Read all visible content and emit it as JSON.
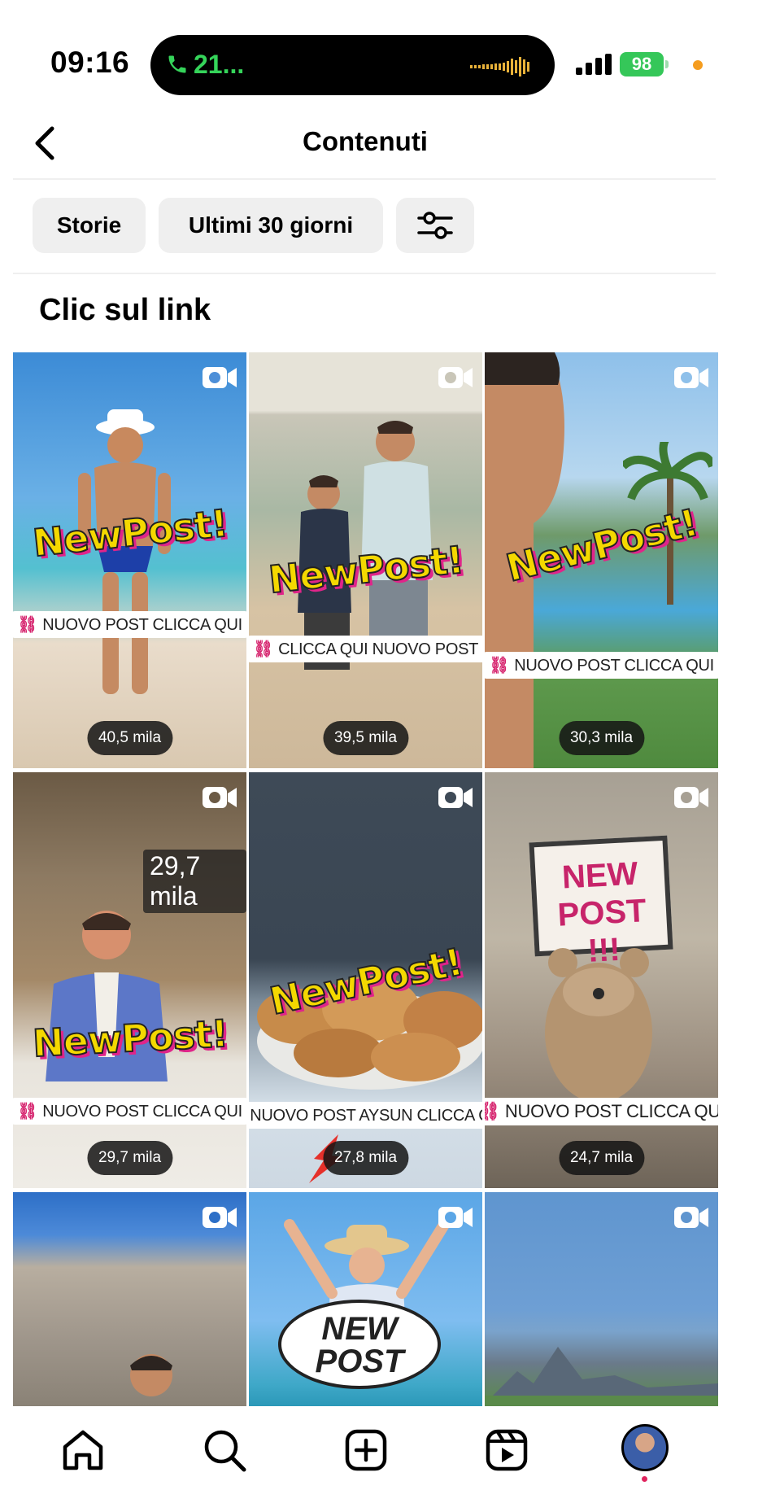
{
  "status_bar": {
    "time": "09:16",
    "call_label": "21...",
    "battery": "98"
  },
  "header": {
    "title": "Contenuti"
  },
  "filters": {
    "type": "Storie",
    "period": "Ultimi 30 giorni"
  },
  "section": {
    "title": "Clic sul link"
  },
  "grid": [
    {
      "stat": "40,5 mila",
      "sticker": "NUOVO POST CLICCA QUI",
      "headline": "NewPost!"
    },
    {
      "stat": "39,5 mila",
      "sticker": "CLICCA QUI NUOVO POST",
      "headline": "NewPost!"
    },
    {
      "stat": "30,3 mila",
      "sticker": "NUOVO POST CLICCA QUI",
      "headline": "NewPost!"
    },
    {
      "stat": "29,7 mila",
      "sticker": "NUOVO POST CLICCA QUI",
      "headline": "NewPost!",
      "overlay": "29,7 mila"
    },
    {
      "stat": "27,8 mila",
      "sticker": "NUOVO POST AYSUN CLICCA QUI",
      "headline": "NewPost!"
    },
    {
      "stat": "24,7 mila",
      "sticker": "NUOVO POST CLICCA QUI",
      "headline": "NEW POST !!!"
    },
    {
      "stat": "",
      "sticker": "",
      "headline": ""
    },
    {
      "stat": "",
      "sticker": "",
      "headline": "NEW POST"
    },
    {
      "stat": "",
      "sticker": "",
      "headline": ""
    }
  ],
  "nav": {
    "icons": [
      "home-icon",
      "search-icon",
      "create-icon",
      "reels-icon",
      "profile-avatar"
    ]
  },
  "colors": {
    "call_green": "#35d45a",
    "battery_green": "#35c759",
    "chip_bg": "#efefef",
    "notification_dot": "#e0245e"
  }
}
